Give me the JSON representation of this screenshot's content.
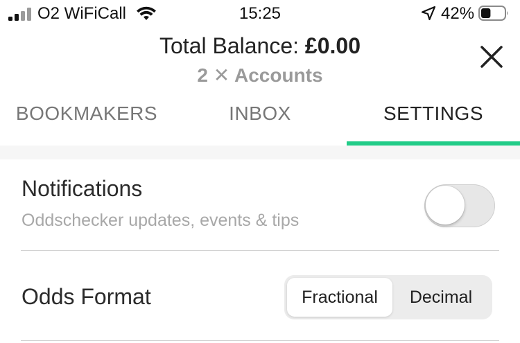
{
  "status_bar": {
    "carrier": "O2 WiFiCall",
    "time": "15:25",
    "battery_percent": "42%",
    "battery_level": 0.42,
    "icons": [
      "signal-icon",
      "wifi-icon",
      "location-arrow-icon",
      "battery-icon"
    ]
  },
  "header": {
    "balance_label": "Total Balance:",
    "balance_value": "£0.00",
    "accounts_count": "2",
    "accounts_x": "✕",
    "accounts_label": "Accounts",
    "close_icon": "close-icon"
  },
  "tabs": [
    {
      "label": "BOOKMAKERS",
      "active": false
    },
    {
      "label": "INBOX",
      "active": false
    },
    {
      "label": "SETTINGS",
      "active": true
    }
  ],
  "settings": {
    "notifications": {
      "title": "Notifications",
      "subtitle": "Oddschecker updates, events & tips",
      "enabled": false
    },
    "odds_format": {
      "title": "Odds Format",
      "options": [
        "Fractional",
        "Decimal"
      ],
      "selected": "Fractional"
    }
  },
  "colors": {
    "accent": "#22cc88",
    "text_primary": "#2b2b2b",
    "text_secondary": "#a8a8a8"
  }
}
